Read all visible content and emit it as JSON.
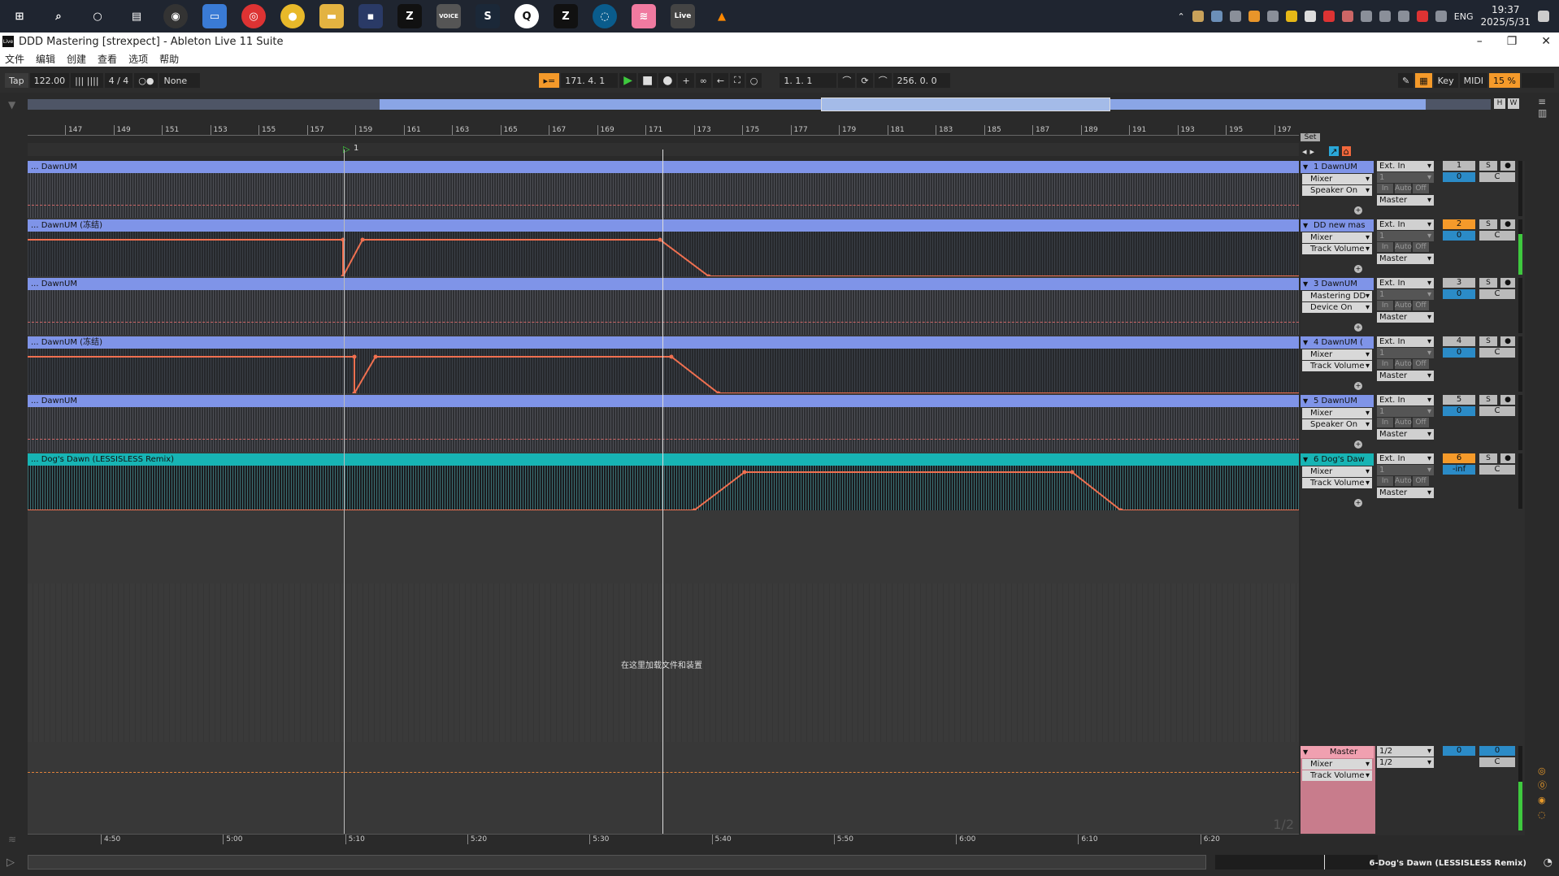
{
  "taskbar": {
    "apps": [
      "start",
      "search",
      "cortana",
      "task-view",
      "app-a",
      "app-b",
      "netease",
      "chrome",
      "explorer",
      "app-c",
      "z-app",
      "voicemeeter",
      "steam",
      "qq",
      "z-app-2",
      "app-d",
      "app-e",
      "ableton",
      "vlc"
    ],
    "tray": {
      "lang": "ENG",
      "time": "19:37",
      "date": "2025/5/31"
    }
  },
  "window": {
    "title": "DDD Mastering  [strexpect] - Ableton Live 11 Suite",
    "logo": "Live"
  },
  "menu": [
    "文件",
    "编辑",
    "创建",
    "查看",
    "选项",
    "帮助"
  ],
  "control": {
    "tap": "Tap",
    "tempo": "122.00",
    "sig": "4 / 4",
    "quant": "None",
    "position": "171.  4.  1",
    "loop_start": "1.  1.  1",
    "loop_len": "256.  0.  0",
    "key": "Key",
    "midi": "MIDI",
    "cpu": "15 %"
  },
  "hw": [
    "H",
    "W"
  ],
  "ruler": {
    "bars": [
      "147",
      "149",
      "151",
      "153",
      "155",
      "157",
      "159",
      "161",
      "163",
      "165",
      "167",
      "169",
      "171",
      "173",
      "175",
      "177",
      "179",
      "181",
      "183",
      "185",
      "187",
      "189",
      "191",
      "193",
      "195",
      "197"
    ]
  },
  "loop_marker": "1",
  "set": "Set",
  "tracks": [
    {
      "clip": "... DawnUM",
      "name": "1 DawnUM",
      "input": "Ext. In",
      "input_ch": "1",
      "mix1": "Mixer",
      "mix2": "Speaker On",
      "out": "Master",
      "num": "1",
      "vol": "0",
      "pan": "C",
      "color": "#7f94e8",
      "monitor": [
        "In",
        "Auto",
        "Off"
      ]
    },
    {
      "clip": "... DawnUM (冻结)",
      "name": "DD new mas",
      "input": "Ext. In",
      "input_ch": "1",
      "mix1": "Mixer",
      "mix2": "Track Volume",
      "out": "Master",
      "num": "2",
      "vol": "0",
      "pan": "C",
      "color": "#7f94e8",
      "monitor": [
        "In",
        "Auto",
        "Off"
      ]
    },
    {
      "clip": "... DawnUM",
      "name": "3 DawnUM",
      "input": "Ext. In",
      "input_ch": "1",
      "mix1": "Mastering DD",
      "mix2": "Device On",
      "out": "Master",
      "num": "3",
      "vol": "0",
      "pan": "C",
      "color": "#7f94e8",
      "monitor": [
        "In",
        "Auto",
        "Off"
      ]
    },
    {
      "clip": "... DawnUM (冻结)",
      "name": "4 DawnUM (",
      "input": "Ext. In",
      "input_ch": "1",
      "mix1": "Mixer",
      "mix2": "Track Volume",
      "out": "Master",
      "num": "4",
      "vol": "0",
      "pan": "C",
      "color": "#7f94e8",
      "monitor": [
        "In",
        "Auto",
        "Off"
      ]
    },
    {
      "clip": "... DawnUM",
      "name": "5 DawnUM",
      "input": "Ext. In",
      "input_ch": "1",
      "mix1": "Mixer",
      "mix2": "Speaker On",
      "out": "Master",
      "num": "5",
      "vol": "0",
      "pan": "C",
      "color": "#7f94e8",
      "monitor": [
        "In",
        "Auto",
        "Off"
      ]
    },
    {
      "clip": "... Dog's Dawn (LESSISLESS Remix)",
      "name": "6 Dog's Daw",
      "input": "Ext. In",
      "input_ch": "1",
      "mix1": "Mixer",
      "mix2": "Track Volume",
      "out": "Master",
      "num": "6",
      "vol": "-inf",
      "pan": "C",
      "color": "#17b4b4",
      "monitor": [
        "In",
        "Auto",
        "Off"
      ]
    }
  ],
  "dropzone_text": "在这里加载文件和装置",
  "master": {
    "name": "Master",
    "mix1": "Mixer",
    "mix2": "Track Volume",
    "out1": "1/2",
    "out2": "1/2",
    "vol": "0",
    "cue": "0",
    "pan": "C",
    "page": "1/2"
  },
  "time_ticks": [
    "4:50",
    "5:00",
    "5:10",
    "5:20",
    "5:30",
    "5:40",
    "5:50",
    "6:00",
    "6:10",
    "6:20"
  ],
  "status": "6-Dog's Dawn (LESSISLESS Remix)"
}
